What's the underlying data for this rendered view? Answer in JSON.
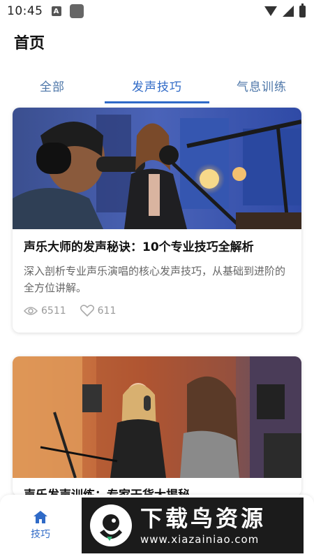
{
  "status_bar": {
    "time": "10:45",
    "notification_letter": "A"
  },
  "header": {
    "title": "首页"
  },
  "tabs": [
    {
      "label": "全部",
      "active": false
    },
    {
      "label": "发声技巧",
      "active": true
    },
    {
      "label": "气息训练",
      "active": false
    }
  ],
  "articles": [
    {
      "title": "声乐大师的发声秘诀：10个专业技巧全解析",
      "description": "深入剖析专业声乐演唱的核心发声技巧，从基础到进阶的全方位讲解。",
      "views": "6511",
      "likes": "611",
      "image": "studio-singers-photo"
    },
    {
      "title_partial": "声乐发声训练：专家干货大揭秘",
      "image": "recording-session-photo"
    }
  ],
  "bottom_nav": {
    "home_label": "技巧"
  },
  "watermark": {
    "title": "下载鸟资源",
    "url": "www.xiazainiao.com"
  },
  "colors": {
    "accent": "#2f6ac7",
    "tab_inactive": "#4d76a8"
  }
}
